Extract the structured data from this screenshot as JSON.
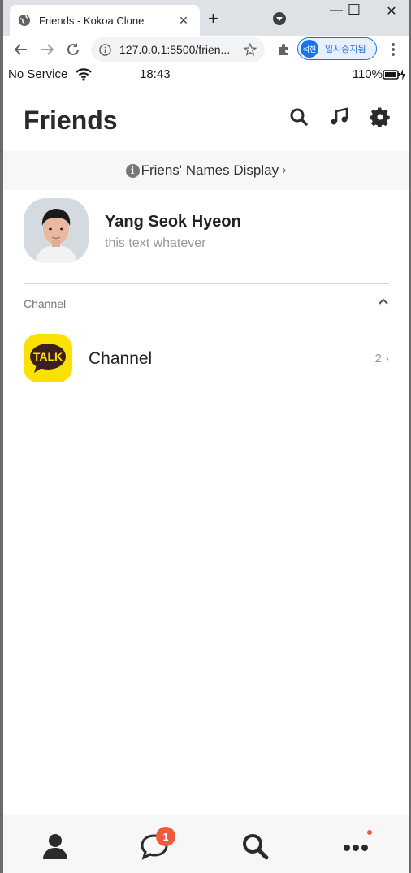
{
  "browser": {
    "tab_title": "Friends - Kokoa Clone",
    "url": "127.0.0.1:5500/frien...",
    "profile_initials": "석현",
    "profile_label": "일시중지됨"
  },
  "statusbar": {
    "carrier": "No Service",
    "time": "18:43",
    "battery": "110%"
  },
  "header": {
    "title": "Friends"
  },
  "notice": {
    "text": "Friens' Names Display"
  },
  "me": {
    "name": "Yang Seok Hyeon",
    "status": "this text whatever"
  },
  "channel_section": {
    "label": "Channel",
    "item_name": "Channel",
    "item_count": "2",
    "logo_text": "TALK"
  },
  "tabbar": {
    "chat_badge": "1"
  },
  "colors": {
    "kakao_yellow": "#fae100",
    "badge_red": "#f05a3c"
  }
}
